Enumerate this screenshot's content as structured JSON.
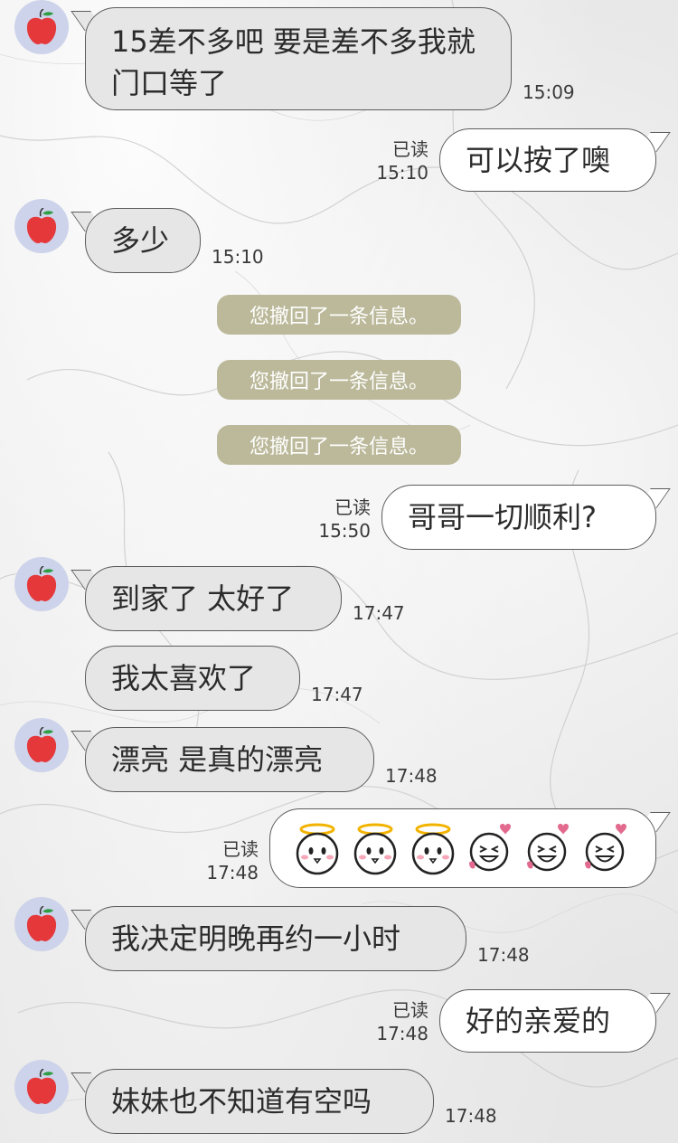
{
  "messages": [
    {
      "side": "in",
      "text": "15差不多吧 要是差不多我就门口等了",
      "time": "15:09"
    },
    {
      "side": "out",
      "text": "可以按了噢",
      "read": "已读",
      "time": "15:10"
    },
    {
      "side": "in",
      "text": "多少",
      "time": "15:10"
    },
    {
      "side": "system",
      "text": "您撤回了一条信息。"
    },
    {
      "side": "system",
      "text": "您撤回了一条信息。"
    },
    {
      "side": "system",
      "text": "您撤回了一条信息。"
    },
    {
      "side": "out",
      "text": "哥哥一切顺利?",
      "read": "已读",
      "time": "15:50"
    },
    {
      "side": "in",
      "text": "到家了 太好了",
      "time": "17:47"
    },
    {
      "side": "in",
      "text": "我太喜欢了",
      "time": "17:47"
    },
    {
      "side": "in",
      "text": "漂亮 是真的漂亮",
      "time": "17:48"
    },
    {
      "side": "out",
      "type": "stickers",
      "stickers": [
        "angel-face-sticker",
        "angel-face-sticker",
        "angel-face-sticker",
        "love-laugh-sticker",
        "love-laugh-sticker",
        "love-laugh-sticker"
      ],
      "read": "已读",
      "time": "17:48"
    },
    {
      "side": "in",
      "text": "我决定明晚再约一小时",
      "time": "17:48"
    },
    {
      "side": "out",
      "text": "好的亲爱的",
      "read": "已读",
      "time": "17:48"
    },
    {
      "side": "in",
      "text": "妹妹也不知道有空吗",
      "time": "17:48"
    }
  ],
  "avatar": {
    "icon": "apple-icon",
    "bg_color": "#cdd3ea"
  },
  "colors": {
    "incoming_bubble": "#e6e6e6",
    "outgoing_bubble": "#ffffff",
    "recall_pill": "#bbb99a"
  }
}
